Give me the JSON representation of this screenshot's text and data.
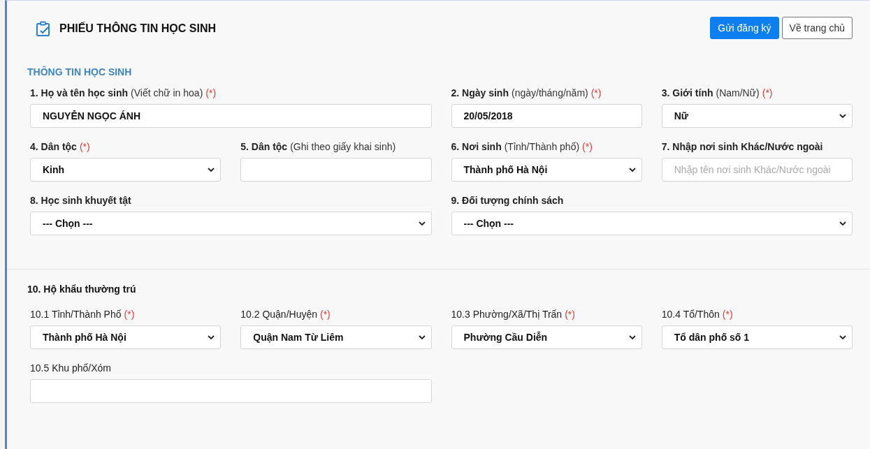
{
  "header": {
    "title": "PHIẾU THÔNG TIN HỌC SINH",
    "buttons": [
      {
        "label": "Gửi đăng ký",
        "kind": "primary"
      },
      {
        "label": "Về trang chủ",
        "kind": "outline"
      }
    ]
  },
  "section": {
    "title": "THÔNG TIN HỌC SINH",
    "fields": [
      {
        "label": "1. Họ và tên học sinh",
        "hint": "(Viết chữ in hoa)",
        "required_mark": "(*)",
        "kind": "text",
        "value": "NGUYỄN NGỌC ÁNH",
        "wide": true
      },
      {
        "label": "2. Ngày sinh",
        "hint": "(ngày/tháng/năm)",
        "required_mark": "(*)",
        "kind": "text",
        "value": "20/05/2018",
        "wide": false
      },
      {
        "label": "3. Giới tính",
        "hint": "(Nam/Nữ)",
        "required_mark": "(*)",
        "kind": "select",
        "value": "Nữ",
        "wide": false
      },
      {
        "label": "4. Dân tộc",
        "required_mark": "(*)",
        "kind": "select",
        "value": "Kinh",
        "wide": false
      },
      {
        "label": "5. Dân tộc",
        "hint": "(Ghi theo giấy khai sinh)",
        "kind": "text",
        "wide": false
      },
      {
        "label": "6. Nơi sinh",
        "hint": "(Tỉnh/Thành phố)",
        "required_mark": "(*)",
        "kind": "select",
        "value": "Thành phố Hà Nội",
        "wide": false
      },
      {
        "label": "7. Nhập nơi sinh Khác/Nước ngoài",
        "kind": "text",
        "placeholder": "Nhập tên nơi sinh Khác/Nước ngoài",
        "wide": false
      },
      {
        "label": "8. Học sinh khuyết tật",
        "kind": "select",
        "value": "--- Chọn ---",
        "wide": true
      },
      {
        "label": "9. Đối tượng chính sách",
        "kind": "select",
        "value": "--- Chọn ---",
        "wide": true
      }
    ]
  },
  "residence": {
    "title": "10. Hộ khẩu thường trú",
    "fields": [
      {
        "label": "10.1 Tỉnh/Thành Phố",
        "required_mark": "(*)",
        "kind": "select",
        "value": "Thành phố Hà Nội",
        "wide": false
      },
      {
        "label": "10.2 Quận/Huyện",
        "required_mark": "(*)",
        "kind": "select",
        "value": "Quận Nam Từ Liêm",
        "wide": false
      },
      {
        "label": "10.3 Phường/Xã/Thị Trấn",
        "required_mark": "(*)",
        "kind": "select",
        "value": "Phường Cầu Diễn",
        "wide": false
      },
      {
        "label": "10.4 Tổ/Thôn",
        "required_mark": "(*)",
        "kind": "select",
        "value": "Tổ dân phố số 1",
        "wide": false
      },
      {
        "label": "10.5 Khu phố/Xóm",
        "kind": "text",
        "wide": true
      }
    ]
  }
}
